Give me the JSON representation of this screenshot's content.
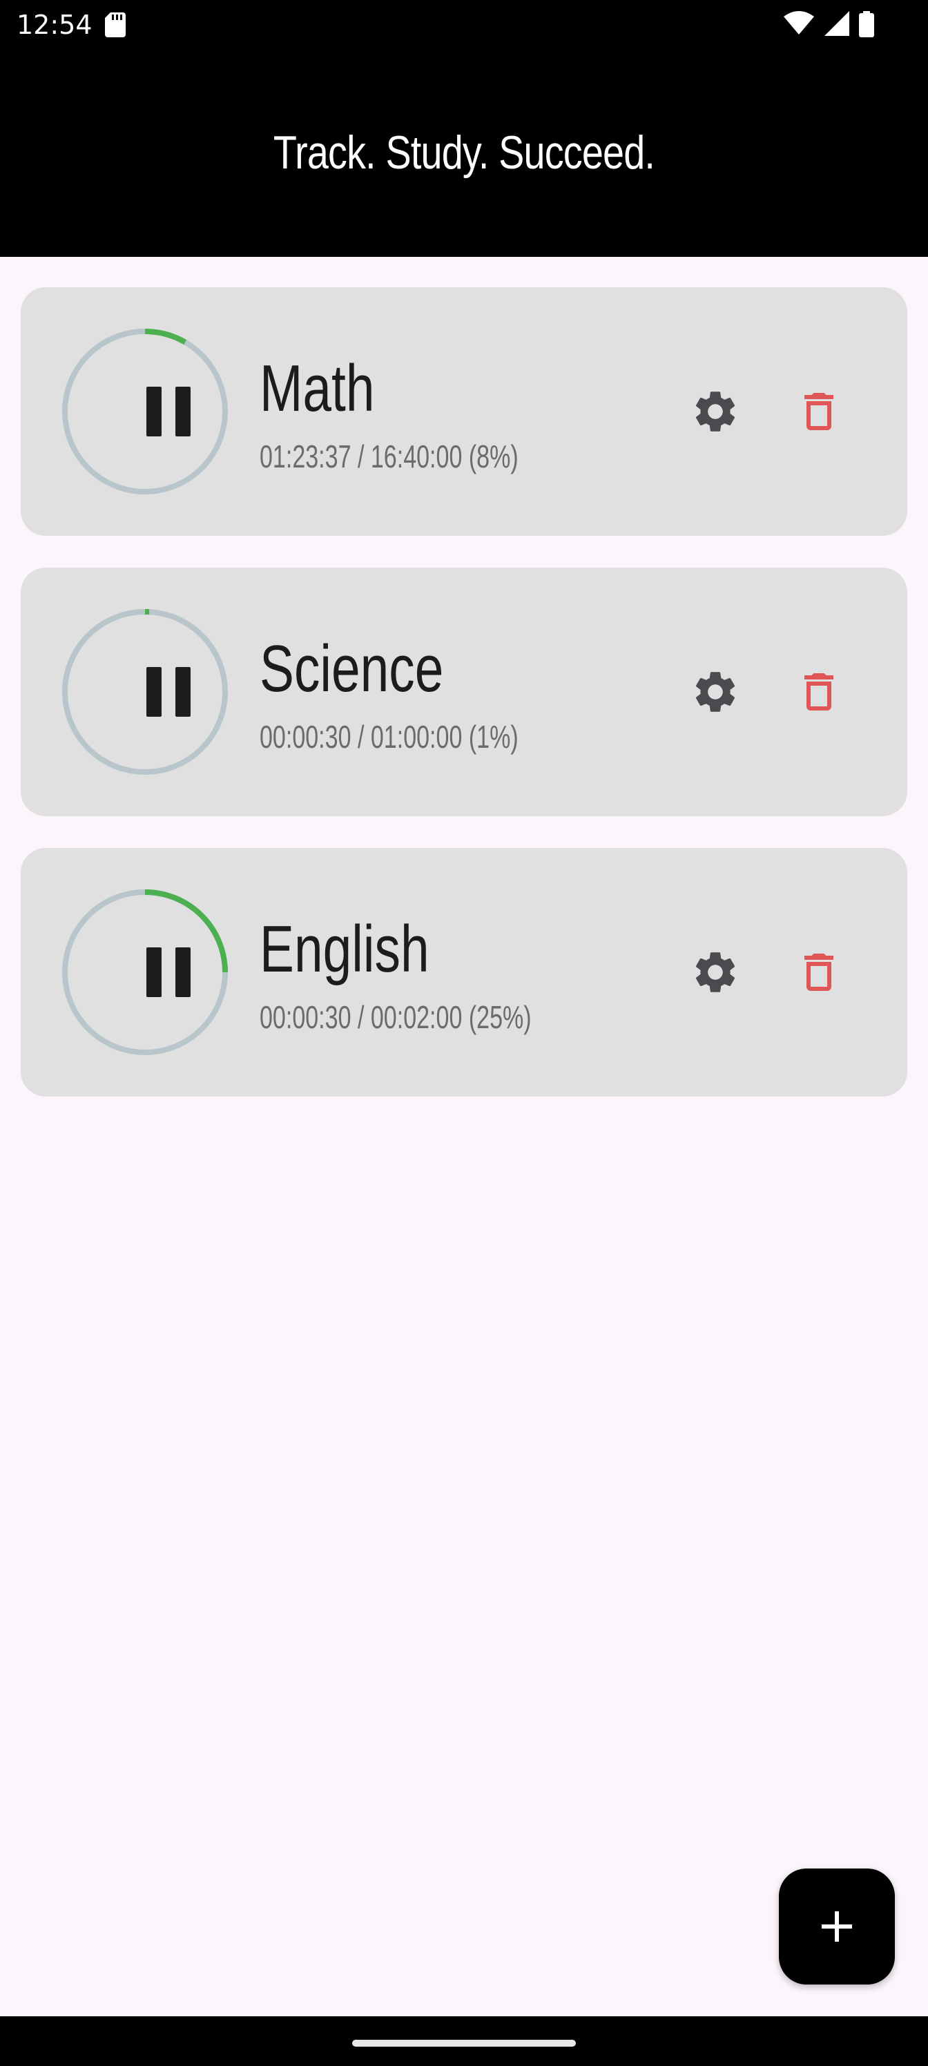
{
  "status_bar": {
    "time": "12:54",
    "icons": [
      "sd-card-icon",
      "wifi-icon",
      "signal-icon",
      "battery-icon"
    ]
  },
  "header": {
    "title": "Track. Study. Succeed."
  },
  "colors": {
    "header_bg": "#000000",
    "page_bg": "#FCF6FC",
    "card_bg": "#E0E0E0",
    "ring_track": "#B8C6CB",
    "ring_progress": "#4CAF50",
    "gear": "#4A4A4F",
    "trash": "#E05555"
  },
  "subjects": [
    {
      "name": "Math",
      "progress_text": "01:23:37 / 16:40:00 (8%)",
      "progress": 0.0836
    },
    {
      "name": "Science",
      "progress_text": "00:00:30 / 01:00:00 (1%)",
      "progress": 0.0083
    },
    {
      "name": "English",
      "progress_text": "00:00:30 / 00:02:00 (25%)",
      "progress": 0.25
    }
  ],
  "fab": {
    "icon": "plus-icon"
  }
}
